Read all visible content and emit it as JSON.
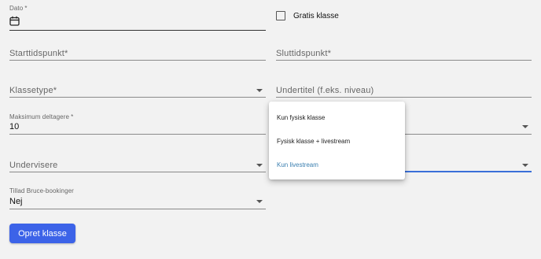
{
  "form": {
    "dato_label": "Dato",
    "dato_required": "*",
    "gratis_label": "Gratis klasse",
    "start_placeholder": "Starttidspunkt*",
    "slut_placeholder": "Sluttidspunkt*",
    "klassetype_placeholder": "Klassetype*",
    "undertitel_placeholder": "Undertitel (f.eks. niveau)",
    "max_label": "Maksimum deltagere",
    "max_required": "*",
    "max_value": "10",
    "undervisere_placeholder": "Undervisere",
    "bruce_label": "Tillad Bruce-bookinger",
    "bruce_value": "Nej",
    "submit_label": "Opret klasse"
  },
  "dropdown": {
    "items": [
      {
        "label": "Kun fysisk klasse"
      },
      {
        "label": "Fysisk klasse + livestream"
      },
      {
        "label": "Kun livestream"
      }
    ],
    "selected_color": "#3a7fb0"
  },
  "icons": {
    "calendar": "calendar-icon",
    "caret": "chevron-down-icon"
  }
}
